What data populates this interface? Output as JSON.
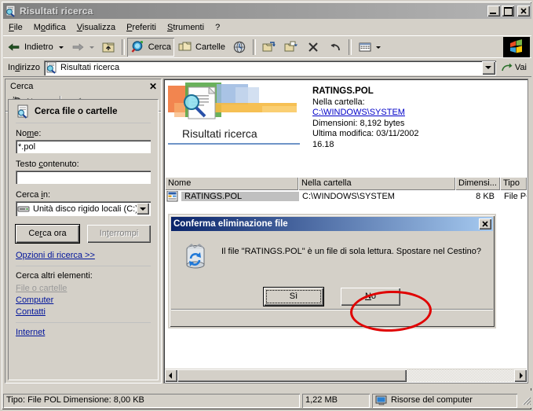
{
  "window": {
    "title": "Risultati ricerca",
    "icon": "search-results-icon",
    "minimize_label": "_",
    "maximize_label": "□",
    "close_label": "✕"
  },
  "menu": [
    {
      "label": "File",
      "accel": "F"
    },
    {
      "label": "Modifica",
      "accel": "M"
    },
    {
      "label": "Visualizza",
      "accel": "V"
    },
    {
      "label": "Preferiti",
      "accel": "P"
    },
    {
      "label": "Strumenti",
      "accel": "S"
    },
    {
      "label": "?",
      "accel": ""
    }
  ],
  "toolbar": {
    "back_label": "Indietro",
    "back_icon": "arrow-left-icon",
    "forward_icon": "arrow-right-icon",
    "up_icon": "folder-up-icon",
    "search_label": "Cerca",
    "search_icon": "search-icon",
    "folders_label": "Cartelle",
    "folders_icon": "folders-icon",
    "history_icon": "history-globe-icon",
    "moveto_icon": "move-to-icon",
    "copyto_icon": "copy-to-icon",
    "delete_icon": "delete-x-icon",
    "undo_icon": "undo-icon",
    "views_icon": "views-icon",
    "logo_icon": "windows-logo-icon"
  },
  "address": {
    "label": "Indirizzo",
    "icon": "search-results-icon",
    "value": "Risultati ricerca",
    "dropdown_icon": "chevron-down-icon",
    "go_label": "Vai",
    "go_icon": "go-arrow-icon"
  },
  "search_pane": {
    "header_title": "Cerca",
    "close_label": "✕",
    "new_label": "Nuovo",
    "new_icon": "new-search-icon",
    "book_icon": "help-book-icon",
    "section_title": "Cerca file o cartelle",
    "section_icon": "file-search-icon",
    "name_label": "Nome:",
    "name_value": "*.pol",
    "name_placeholder": "",
    "text_label": "Testo contenuto:",
    "text_value": "",
    "text_placeholder": "",
    "searchin_label": "Cerca in:",
    "searchin_value": "Unità disco rigido locali (C:)",
    "searchin_icon": "drive-icon",
    "search_now_label": "Cerca ora",
    "stop_label": "Interrompi",
    "options_link": "Opzioni di ricerca >>",
    "other_items_label": "Cerca altri elementi:",
    "other_links": [
      {
        "label": "File o cartelle",
        "disabled": true
      },
      {
        "label": "Computer",
        "disabled": false
      },
      {
        "label": "Contatti",
        "disabled": false
      }
    ],
    "internet_link": "Internet"
  },
  "details": {
    "banner_label": "Risultati ricerca",
    "banner_icon": "search-results-banner-icon",
    "file_name": "RATINGS.POL",
    "folder_label": "Nella cartella:",
    "folder_path": "C:\\WINDOWS\\SYSTEM",
    "size_line": "Dimensioni: 8,192 bytes",
    "modified_line": "Ultima modifica: 03/11/2002",
    "modified_time": "16.18"
  },
  "results": {
    "columns": [
      "Nome",
      "Nella cartella",
      "Dimensi...",
      "Tipo"
    ],
    "rows": [
      {
        "icon": "pol-file-icon",
        "name": "RATINGS.POL",
        "folder": "C:\\WINDOWS\\SYSTEM",
        "size": "8 KB",
        "type": "File POL",
        "selected": true
      }
    ],
    "scroll_left_icon": "arrow-left-icon",
    "scroll_right_icon": "arrow-right-icon"
  },
  "dialog": {
    "title": "Conferma eliminazione file",
    "close_label": "✕",
    "icon": "recycle-bin-icon",
    "message": "Il file \"RATINGS.POL\" è un file di sola lettura. Spostare nel Cestino?",
    "yes_label": "Sì",
    "no_label": "No",
    "highlight_color": "#e00000",
    "highlighted_button": "yes-button"
  },
  "statusbar": {
    "info": "Tipo: File POL Dimensione: 8,00 KB",
    "size": "1,22 MB",
    "zone": "Risorse del computer",
    "zone_icon": "my-computer-icon"
  }
}
